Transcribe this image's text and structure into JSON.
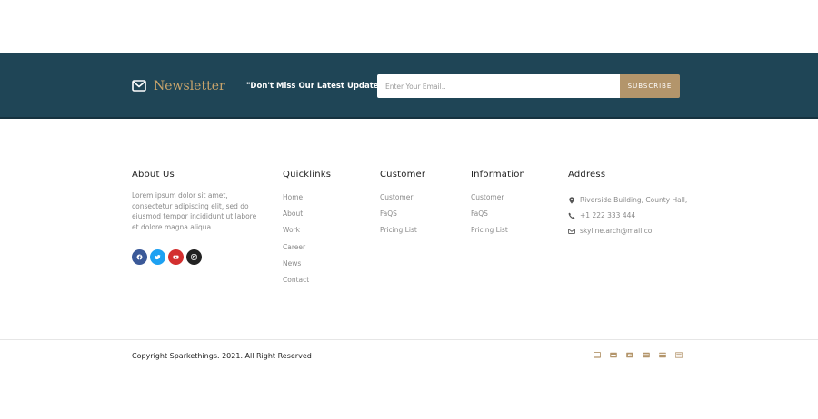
{
  "newsletter": {
    "title": "Newsletter",
    "tagline": "\"Don't Miss Our Latest Update",
    "email_placeholder": "Enter Your Email..",
    "subscribe_label": "SUBSCRIBE"
  },
  "about": {
    "heading": "About Us",
    "text": "Lorem ipsum dolor sit amet, consectetur adipiscing elit, sed do eiusmod tempor incididunt ut labore et dolore magna aliqua."
  },
  "social": [
    {
      "icon": "facebook-icon",
      "color": "#3b5998"
    },
    {
      "icon": "twitter-icon",
      "color": "#1da1f2"
    },
    {
      "icon": "youtube-icon",
      "color": "#d32f2f"
    },
    {
      "icon": "instagram-icon",
      "color": "#222222"
    }
  ],
  "quicklinks": {
    "heading": "Quicklinks",
    "items": [
      "Home",
      "About",
      "Work",
      "Career",
      "News",
      "Contact"
    ]
  },
  "customer": {
    "heading": "Customer",
    "items": [
      "Customer",
      "FaQS",
      "Pricing List"
    ]
  },
  "information": {
    "heading": "Information",
    "items": [
      "Customer",
      "FaQS",
      "Pricing List"
    ]
  },
  "address": {
    "heading": "Address",
    "location": "Riverside Building, County Hall,",
    "phone": "+1 222 333 444",
    "email": "skyline.arch@mail.co"
  },
  "footer": {
    "copyright": "Copyright Sparkethings. 2021. All Right Reserved",
    "payment_icons": [
      "card-icon",
      "visa-icon",
      "mastercard-icon",
      "amex-icon",
      "discover-icon",
      "paypal-icon"
    ]
  },
  "colors": {
    "band": "#1f4556",
    "gold": "#b3956b",
    "heading": "#222222",
    "muted": "#8a8a8a"
  }
}
